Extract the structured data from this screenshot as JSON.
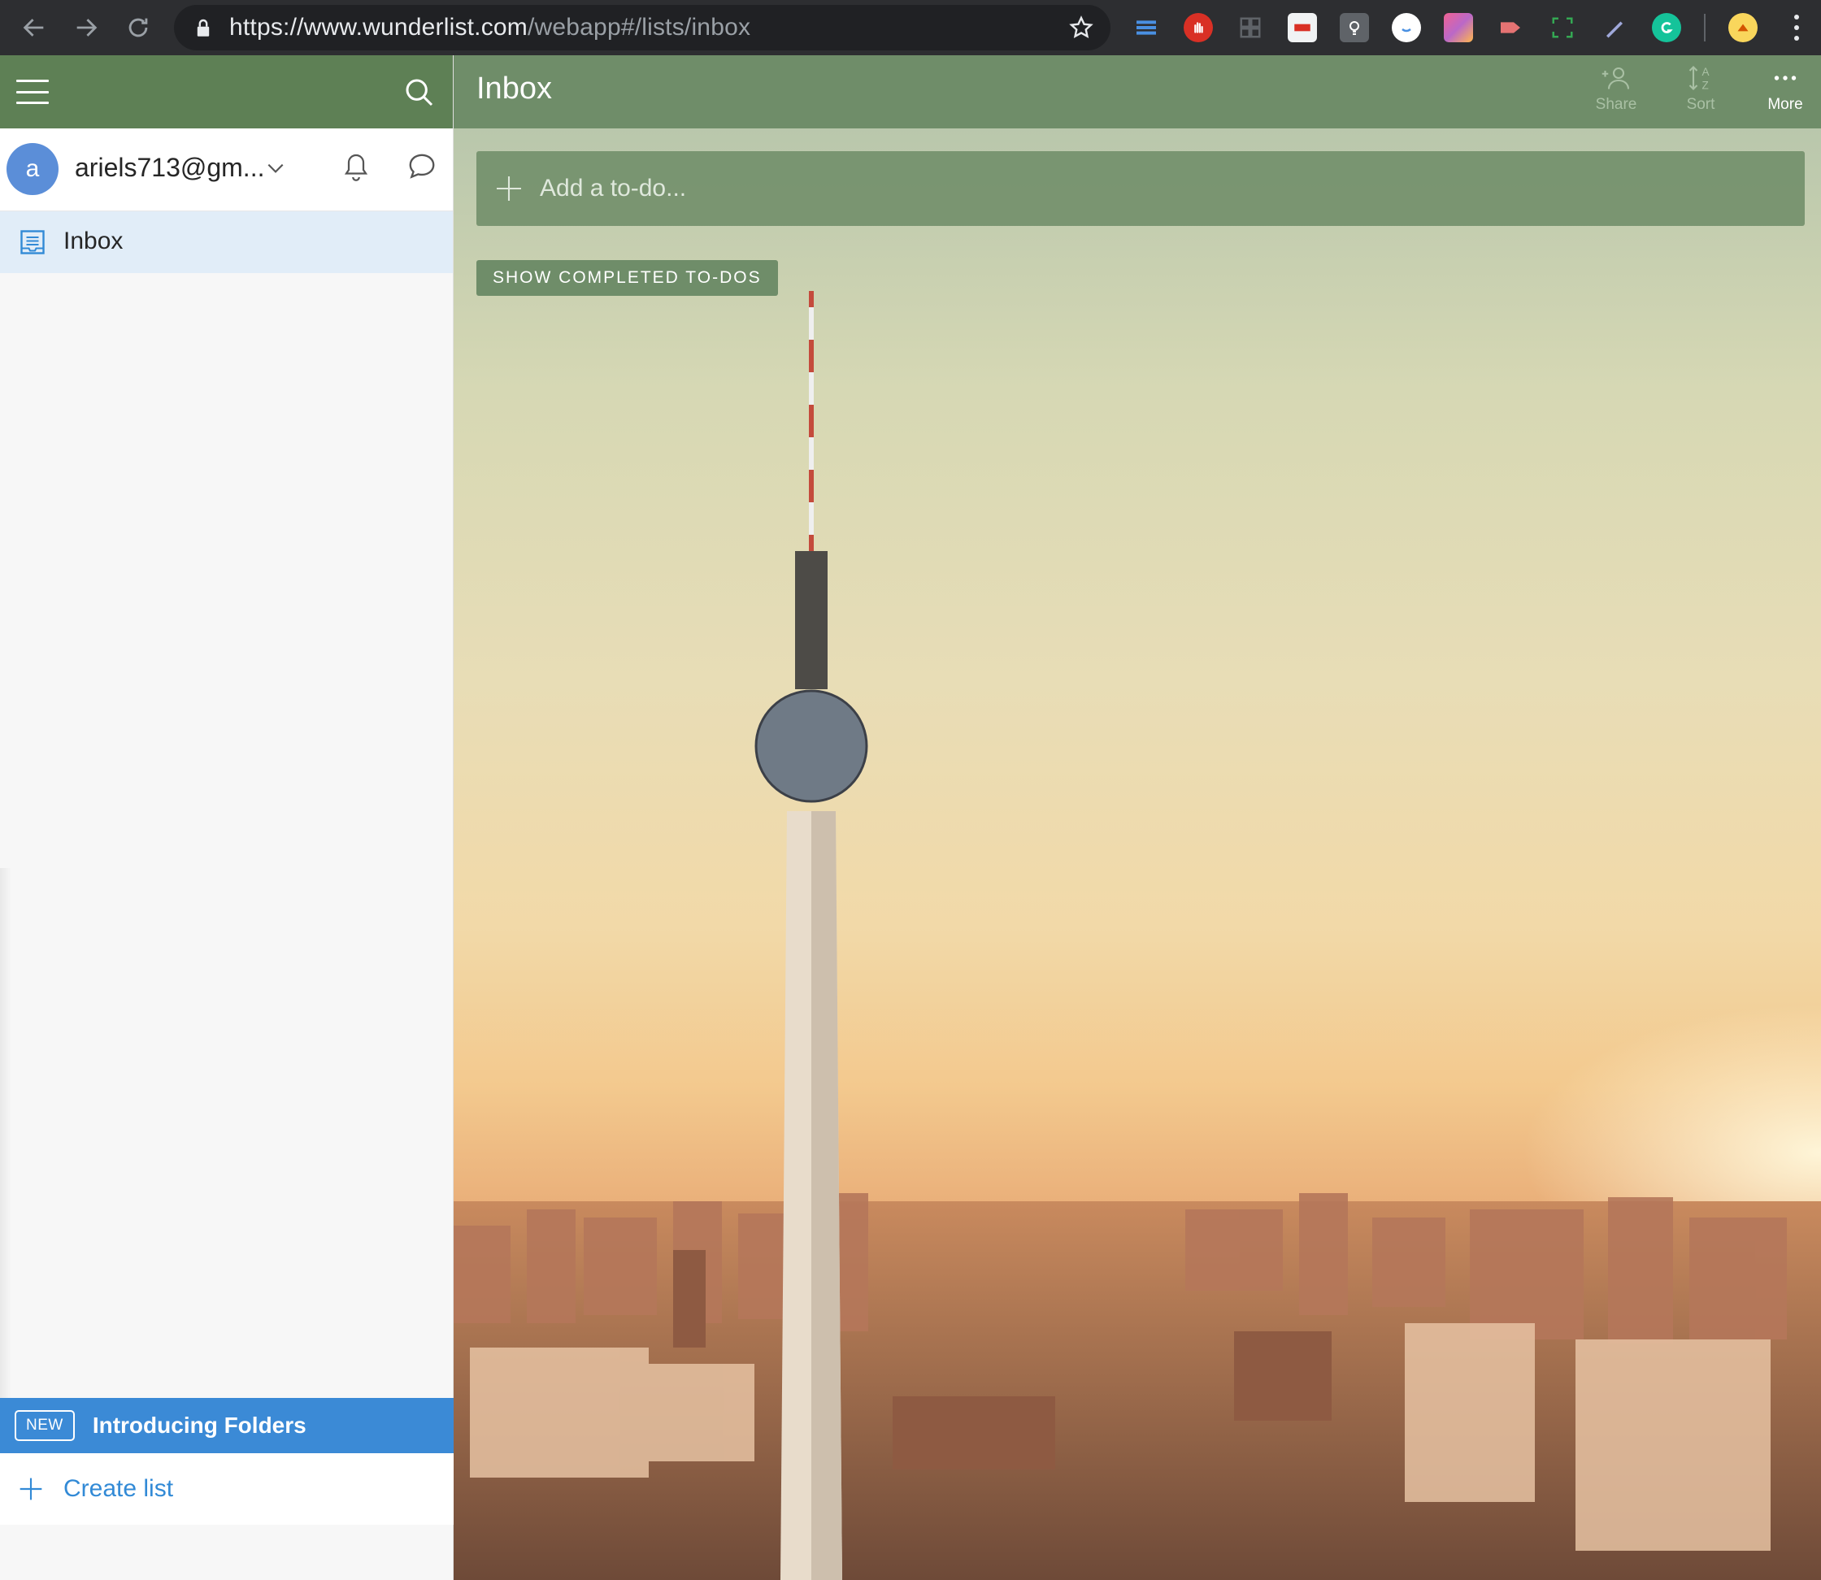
{
  "browser": {
    "url_host": "https://www.wunderlist.com",
    "url_path": "/webapp#/lists/inbox"
  },
  "sidebar": {
    "user": {
      "avatar_letter": "a",
      "name": "ariels713@gm..."
    },
    "lists": [
      {
        "label": "Inbox",
        "icon": "inbox-icon",
        "selected": true
      }
    ],
    "banner": {
      "badge": "NEW",
      "label": "Introducing Folders"
    },
    "create_list_label": "Create list"
  },
  "main": {
    "title": "Inbox",
    "actions": [
      {
        "label": "Share",
        "icon": "add-person-icon"
      },
      {
        "label": "Sort",
        "icon": "sort-az-icon"
      },
      {
        "label": "More",
        "icon": "more-dots-icon"
      }
    ],
    "add_todo_placeholder": "Add a to-do...",
    "show_completed_label": "SHOW COMPLETED TO-DOS"
  },
  "colors": {
    "header_green": "#6f8d69",
    "sidebar_header_green": "#5e8055",
    "accent_blue": "#3b8ad6",
    "selected_list_bg": "#e1edf8"
  }
}
